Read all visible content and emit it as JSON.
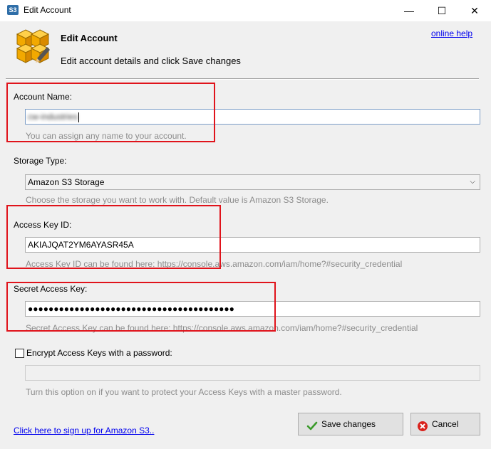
{
  "window": {
    "icon_label": "S3",
    "title": "Edit Account",
    "minimize_glyph": "—",
    "maximize_glyph": "☐",
    "close_glyph": "✕"
  },
  "header": {
    "title": "Edit Account",
    "subtitle": "Edit account details and click Save changes",
    "help_link": "online help",
    "icon": "amazon-s3-boxes-icon"
  },
  "account_name": {
    "label": "Account Name:",
    "value": "cw-industries",
    "hint": "You can assign any name to your account."
  },
  "storage_type": {
    "label": "Storage Type:",
    "selected": "Amazon S3 Storage",
    "hint": "Choose the storage you want to work with. Default value is Amazon S3 Storage."
  },
  "access_key": {
    "label": "Access Key ID:",
    "value": "AKIAJQAT2YM6AYASR45A",
    "hint": "Access Key ID can be found here: https://console.aws.amazon.com/iam/home?#security_credential"
  },
  "secret_key": {
    "label": "Secret Access Key:",
    "value": "●●●●●●●●●●●●●●●●●●●●●●●●●●●●●●●●●●●●●●●●",
    "hint": "Secret Access Key can be found here: https://console.aws.amazon.com/iam/home?#security_credential"
  },
  "encrypt": {
    "label": "Encrypt Access Keys with a password:",
    "checked": false,
    "password_value": "",
    "hint": "Turn this option on if you want to protect your Access Keys with a master password."
  },
  "footer": {
    "signup_link": "Click here to sign up for Amazon S3..",
    "save_label": "Save changes",
    "cancel_label": "Cancel"
  },
  "colors": {
    "highlight": "#e0131b",
    "link": "#0000ee",
    "hint_text": "#8c8c8c"
  }
}
